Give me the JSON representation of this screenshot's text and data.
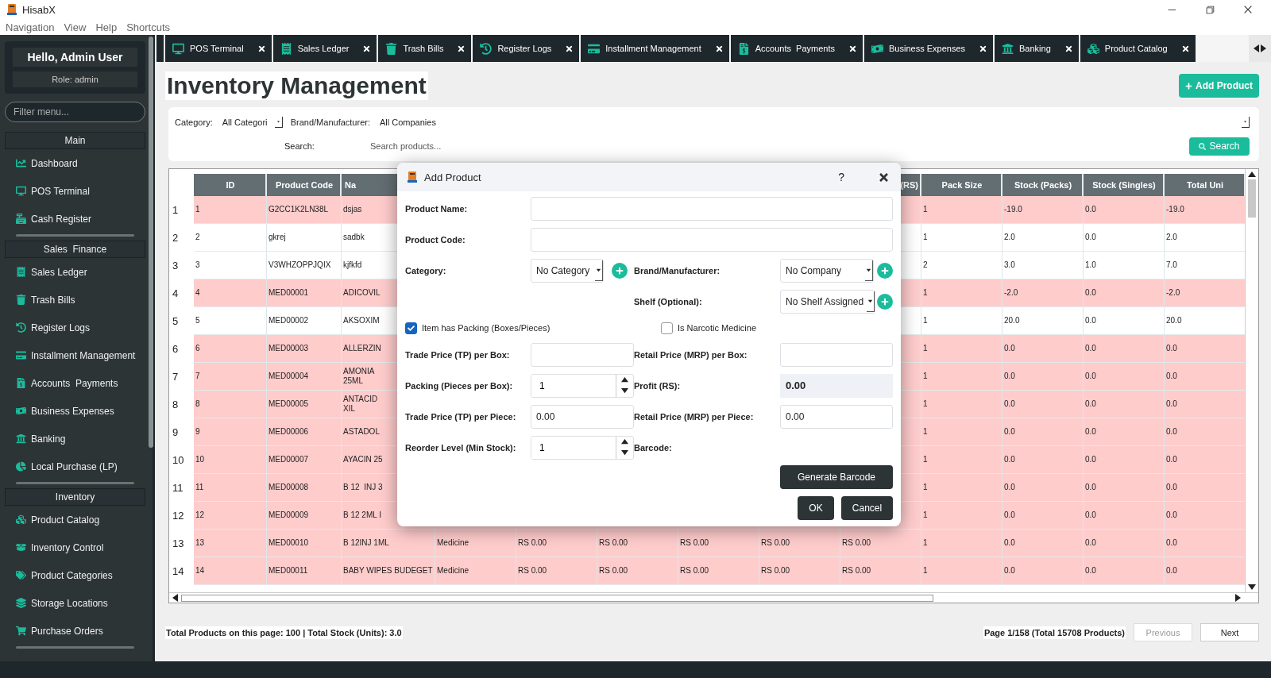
{
  "window": {
    "title": "HisabX"
  },
  "menu": [
    "Navigation",
    "View",
    "Help",
    "Shortcuts"
  ],
  "sidebar": {
    "greeting": "Hello, Admin User",
    "role": "Role: admin",
    "filter_placeholder": "Filter menu...",
    "sections": [
      {
        "title": "Main",
        "items": [
          "Dashboard",
          "POS Terminal",
          "Cash Register"
        ]
      },
      {
        "title": "Sales  Finance",
        "items": [
          "Sales Ledger",
          "Trash Bills",
          "Register Logs",
          "Installment Management",
          "Accounts  Payments",
          "Business Expenses",
          "Banking",
          "Local Purchase (LP)"
        ]
      },
      {
        "title": "Inventory",
        "items": [
          "Product Catalog",
          "Inventory Control",
          "Product Categories",
          "Storage Locations",
          "Purchase Orders"
        ]
      }
    ]
  },
  "tabs": [
    {
      "label": "POS Terminal",
      "selected": false
    },
    {
      "label": "Sales Ledger",
      "selected": false
    },
    {
      "label": "Trash Bills",
      "selected": false
    },
    {
      "label": "Register Logs",
      "selected": false
    },
    {
      "label": "Installment Management",
      "selected": false
    },
    {
      "label": "Accounts  Payments",
      "selected": false
    },
    {
      "label": "Business Expenses",
      "selected": false
    },
    {
      "label": "Banking",
      "selected": false
    },
    {
      "label": "Product Catalog",
      "selected": false
    }
  ],
  "page": {
    "title": "Inventory Management",
    "add_button": "Add Product"
  },
  "filters": {
    "category_label": "Category:",
    "category_value": "All Categori",
    "brand_label": "Brand/Manufacturer:",
    "brand_value": "All Companies",
    "search_label": "Search:",
    "search_placeholder": "Search products...",
    "search_button": "Search"
  },
  "table": {
    "columns": [
      {
        "label": "ID"
      },
      {
        "label": "Product Code"
      },
      {
        "label": "Na"
      },
      null,
      null,
      null,
      null,
      null,
      {
        "label": "(RS)"
      },
      {
        "label": "Pack Size"
      },
      {
        "label": "Stock (Packs)"
      },
      {
        "label": "Stock (Singles)"
      },
      {
        "label": "Total Uni"
      }
    ],
    "rows": [
      {
        "number": "1",
        "low_stock": true,
        "cells": [
          "1",
          "G2CC1K2LN38L",
          "dsjas",
          null,
          null,
          null,
          null,
          null,
          null,
          "1",
          "-19.0",
          "0.0",
          "-19.0"
        ]
      },
      {
        "number": "2",
        "low_stock": false,
        "cells": [
          "2",
          "gkrej",
          "sadbk",
          null,
          null,
          null,
          null,
          null,
          null,
          "1",
          "2.0",
          "0.0",
          "2.0"
        ]
      },
      {
        "number": "3",
        "low_stock": false,
        "cells": [
          "3",
          "V3WHZOPPJQIX",
          "kjfkfd",
          null,
          null,
          null,
          null,
          null,
          null,
          "2",
          "3.0",
          "1.0",
          "7.0"
        ]
      },
      {
        "number": "4",
        "low_stock": true,
        "cells": [
          "4",
          "MED00001",
          "ADICOVIL",
          null,
          null,
          null,
          null,
          null,
          null,
          "1",
          "-2.0",
          "0.0",
          "-2.0"
        ]
      },
      {
        "number": "5",
        "low_stock": false,
        "cells": [
          "5",
          "MED00002",
          "AKSOXIM",
          null,
          null,
          null,
          null,
          null,
          null,
          "1",
          "20.0",
          "0.0",
          "20.0"
        ]
      },
      {
        "number": "6",
        "low_stock": true,
        "cells": [
          "6",
          "MED00003",
          "ALLERZIN",
          null,
          null,
          null,
          null,
          null,
          null,
          "1",
          "0.0",
          "0.0",
          "0.0"
        ]
      },
      {
        "number": "7",
        "low_stock": true,
        "cells": [
          "7",
          "MED00004",
          "AMONIA\n25ML",
          null,
          null,
          null,
          null,
          null,
          null,
          "1",
          "0.0",
          "0.0",
          "0.0"
        ]
      },
      {
        "number": "8",
        "low_stock": true,
        "cells": [
          "8",
          "MED00005",
          "ANTACID\nXIL",
          null,
          null,
          null,
          null,
          null,
          null,
          "1",
          "0.0",
          "0.0",
          "0.0"
        ]
      },
      {
        "number": "9",
        "low_stock": true,
        "cells": [
          "9",
          "MED00006",
          "ASTADOL",
          null,
          null,
          null,
          null,
          null,
          null,
          "1",
          "0.0",
          "0.0",
          "0.0"
        ]
      },
      {
        "number": "10",
        "low_stock": true,
        "cells": [
          "10",
          "MED00007",
          "AYACIN 25",
          null,
          null,
          null,
          null,
          null,
          null,
          "1",
          "0.0",
          "0.0",
          "0.0"
        ]
      },
      {
        "number": "11",
        "low_stock": true,
        "cells": [
          "11",
          "MED00008",
          "B 12  INJ 3",
          null,
          null,
          null,
          null,
          null,
          null,
          "1",
          "0.0",
          "0.0",
          "0.0"
        ]
      },
      {
        "number": "12",
        "low_stock": true,
        "cells": [
          "12",
          "MED00009",
          "B 12 2ML I",
          null,
          null,
          null,
          null,
          null,
          null,
          "1",
          "0.0",
          "0.0",
          "0.0"
        ]
      },
      {
        "number": "13",
        "low_stock": true,
        "cells": [
          "13",
          "MED00010",
          "B 12INJ 1ML",
          "Medicine",
          "RS 0.00",
          "RS 0.00",
          "RS 0.00",
          "RS 0.00",
          "RS 0.00",
          "1",
          "0.0",
          "0.0",
          "0.0"
        ]
      },
      {
        "number": "14",
        "low_stock": true,
        "cells": [
          "14",
          "MED00011",
          "BABY WIPES BUDEGET",
          "Medicine",
          "RS 0.00",
          "RS 0.00",
          "RS 0.00",
          "RS 0.00",
          "RS 0.00",
          "1",
          "0.0",
          "0.0",
          "0.0"
        ]
      }
    ]
  },
  "footer": {
    "summary": "Total Products on this page: 100 | Total Stock (Units): 3.0",
    "page_info": "Page 1/158 (Total 15708 Products)",
    "previous": {
      "label": "Previous",
      "disabled": true
    },
    "next": {
      "label": "Next",
      "disabled": false
    }
  },
  "dialog": {
    "title": "Add Product",
    "help": "?",
    "product_name": {
      "label": "Product Name:"
    },
    "product_code": {
      "label": "Product Code:"
    },
    "category": {
      "label": "Category:",
      "value": "No Category"
    },
    "brand": {
      "label": "Brand/Manufacturer:",
      "value": "No Company"
    },
    "shelf": {
      "label": "Shelf (Optional):",
      "value": "No Shelf Assigned"
    },
    "has_packing": {
      "label": "Item has Packing (Boxes/Pieces)",
      "checked": true
    },
    "narcotic": {
      "label": "Is Narcotic Medicine",
      "checked": false
    },
    "tp_box": {
      "label": "Trade Price (TP) per Box:"
    },
    "mrp_box": {
      "label": "Retail Price (MRP) per Box:"
    },
    "packing": {
      "label": "Packing (Pieces per Box):",
      "value": "1"
    },
    "profit": {
      "label": "Profit (RS):",
      "value": "0.00"
    },
    "tp_piece": {
      "label": "Trade Price (TP) per Piece:",
      "value": "0.00"
    },
    "mrp_piece": {
      "label": "Retail Price (MRP) per Piece:",
      "value": "0.00"
    },
    "reorder": {
      "label": "Reorder Level (Min Stock):",
      "value": "1"
    },
    "barcode": {
      "label": "Barcode:"
    },
    "buttons": {
      "generate": "Generate Barcode",
      "ok": "OK",
      "cancel": "Cancel"
    }
  }
}
